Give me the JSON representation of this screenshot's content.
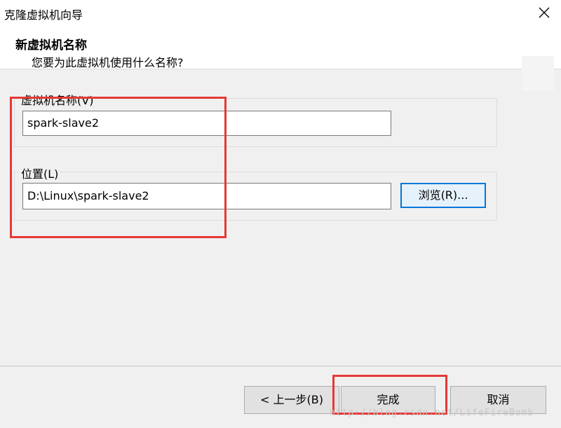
{
  "window": {
    "title": "克隆虚拟机向导"
  },
  "header": {
    "title": "新虚拟机名称",
    "subtitle": "您要为此虚拟机使用什么名称?"
  },
  "vm_name": {
    "label": "虚拟机名称(V)",
    "value": "spark-slave2"
  },
  "location": {
    "label": "位置(L)",
    "value": "D:\\Linux\\spark-slave2",
    "browse_label": "浏览(R)..."
  },
  "footer": {
    "back_label": "< 上一步(B)",
    "finish_label": "完成",
    "cancel_label": "取消"
  },
  "watermark": "http://blog.csdn.net/LifeFireBomb",
  "colors": {
    "highlight": "#e53935",
    "focus_border": "#0078d7"
  },
  "icons": {
    "close": "close-icon"
  }
}
